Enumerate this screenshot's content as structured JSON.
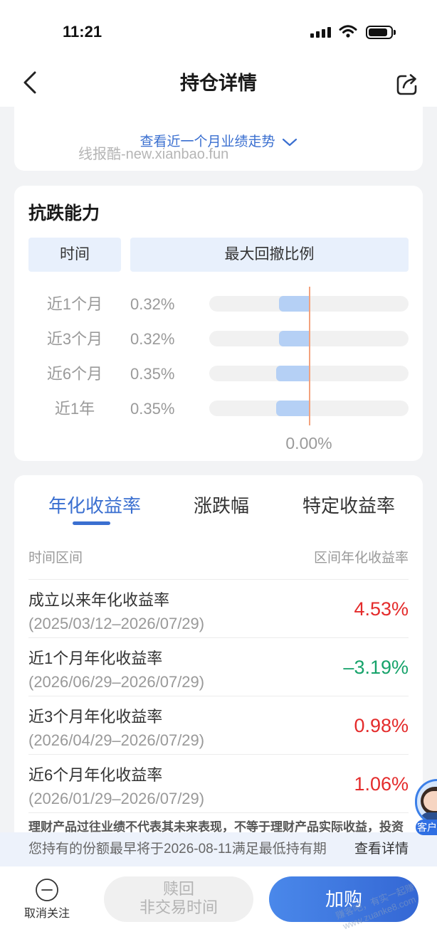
{
  "status_bar": {
    "time": "11:21"
  },
  "nav": {
    "title": "持仓详情"
  },
  "trend_card": {
    "link_label": "查看近一个月业绩走势"
  },
  "watermarks": {
    "top": "线报酷-new.xianbao.fun",
    "bottom_slogan": "赚客吧，有实一起赚",
    "bottom_url": "www.zuanke8.com"
  },
  "drawdown": {
    "title": "抗跌能力",
    "header_time": "时间",
    "header_ratio": "最大回撤比例",
    "rows": [
      {
        "period": "近1个月",
        "value_text": "0.32%",
        "value": 0.32
      },
      {
        "period": "近3个月",
        "value_text": "0.32%",
        "value": 0.32
      },
      {
        "period": "近6个月",
        "value_text": "0.35%",
        "value": 0.35
      },
      {
        "period": "近1年",
        "value_text": "0.35%",
        "value": 0.35
      }
    ],
    "zero_label": "0.00%"
  },
  "returns": {
    "tabs": [
      {
        "label": "年化收益率",
        "active": true
      },
      {
        "label": "涨跌幅",
        "active": false
      },
      {
        "label": "特定收益率",
        "active": false
      }
    ],
    "col_period": "时间区间",
    "col_rate": "区间年化收益率",
    "rows": [
      {
        "title": "成立以来年化收益率",
        "range": "(2025/03/12–2026/07/29)",
        "rate": "4.53%",
        "rate_color": "#e42b2b"
      },
      {
        "title": "近1个月年化收益率",
        "range": "(2026/06/29–2026/07/29)",
        "rate": "–3.19%",
        "rate_color": "#17a36b"
      },
      {
        "title": "近3个月年化收益率",
        "range": "(2026/04/29–2026/07/29)",
        "rate": "0.98%",
        "rate_color": "#e42b2b"
      },
      {
        "title": "近6个月年化收益率",
        "range": "(2026/01/29–2026/07/29)",
        "rate": "1.06%",
        "rate_color": "#e42b2b"
      }
    ],
    "disclaimer": "理财产品过往业绩不代表其未来表现，不等于理财产品实际收益，投资"
  },
  "notice": {
    "text": "您持有的份额最早将于2026-08-11满足最低持有期",
    "link": "查看详情"
  },
  "floating_service": {
    "label": "客户"
  },
  "bottom_bar": {
    "unfollow_label": "取消关注",
    "redeem_label": "赎回",
    "redeem_sub": "非交易时间",
    "buy_label": "加购"
  },
  "icons": {
    "back": "chevron-left-icon",
    "share": "share-icon",
    "expand": "chevron-down-icon",
    "unfollow": "minus-circle-icon",
    "service": "customer-service-avatar"
  },
  "colors": {
    "accent": "#3a6fd0",
    "gain": "#e42b2b",
    "loss": "#17a36b",
    "zero_line": "#f3a27d",
    "drawdown_bar": "#b5d0f5"
  }
}
